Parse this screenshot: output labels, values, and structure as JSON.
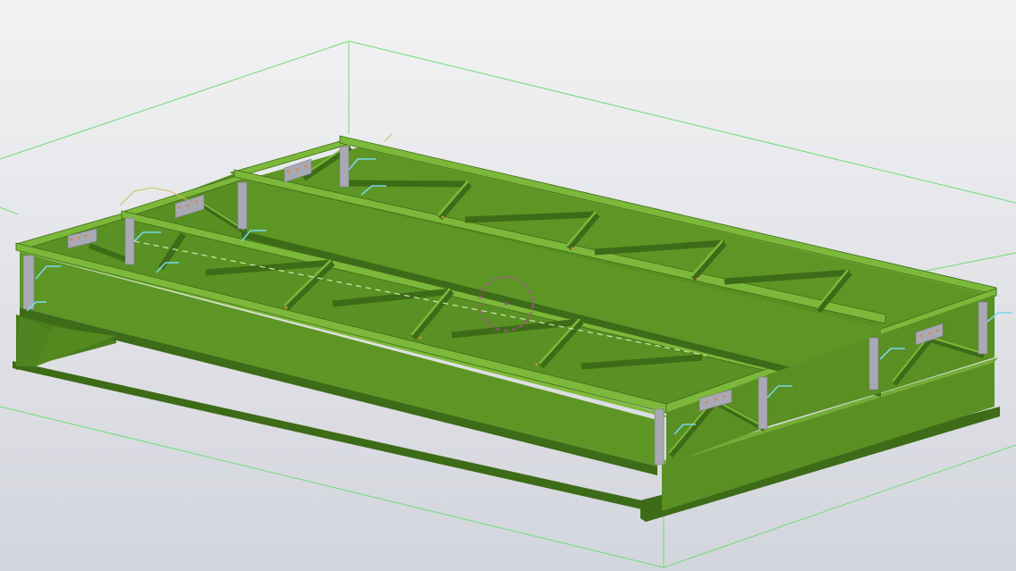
{
  "viewport": {
    "name": "3D model view",
    "background_top": "#f3f3f4",
    "background_bottom": "#d3d5dd"
  },
  "model": {
    "member_color": "#5e9626",
    "member_dark": "#3d6b17",
    "member_light": "#73ad33",
    "connection_plate_color": "#a9a9b4",
    "bounding_box_color": "#6fdc78",
    "marker_color": "#7ad7e8",
    "centerline_color": "#cfe8b0",
    "rotation_center_color": "#b04b9a"
  },
  "icons": {
    "rotation_center": "rotation-center-icon"
  }
}
